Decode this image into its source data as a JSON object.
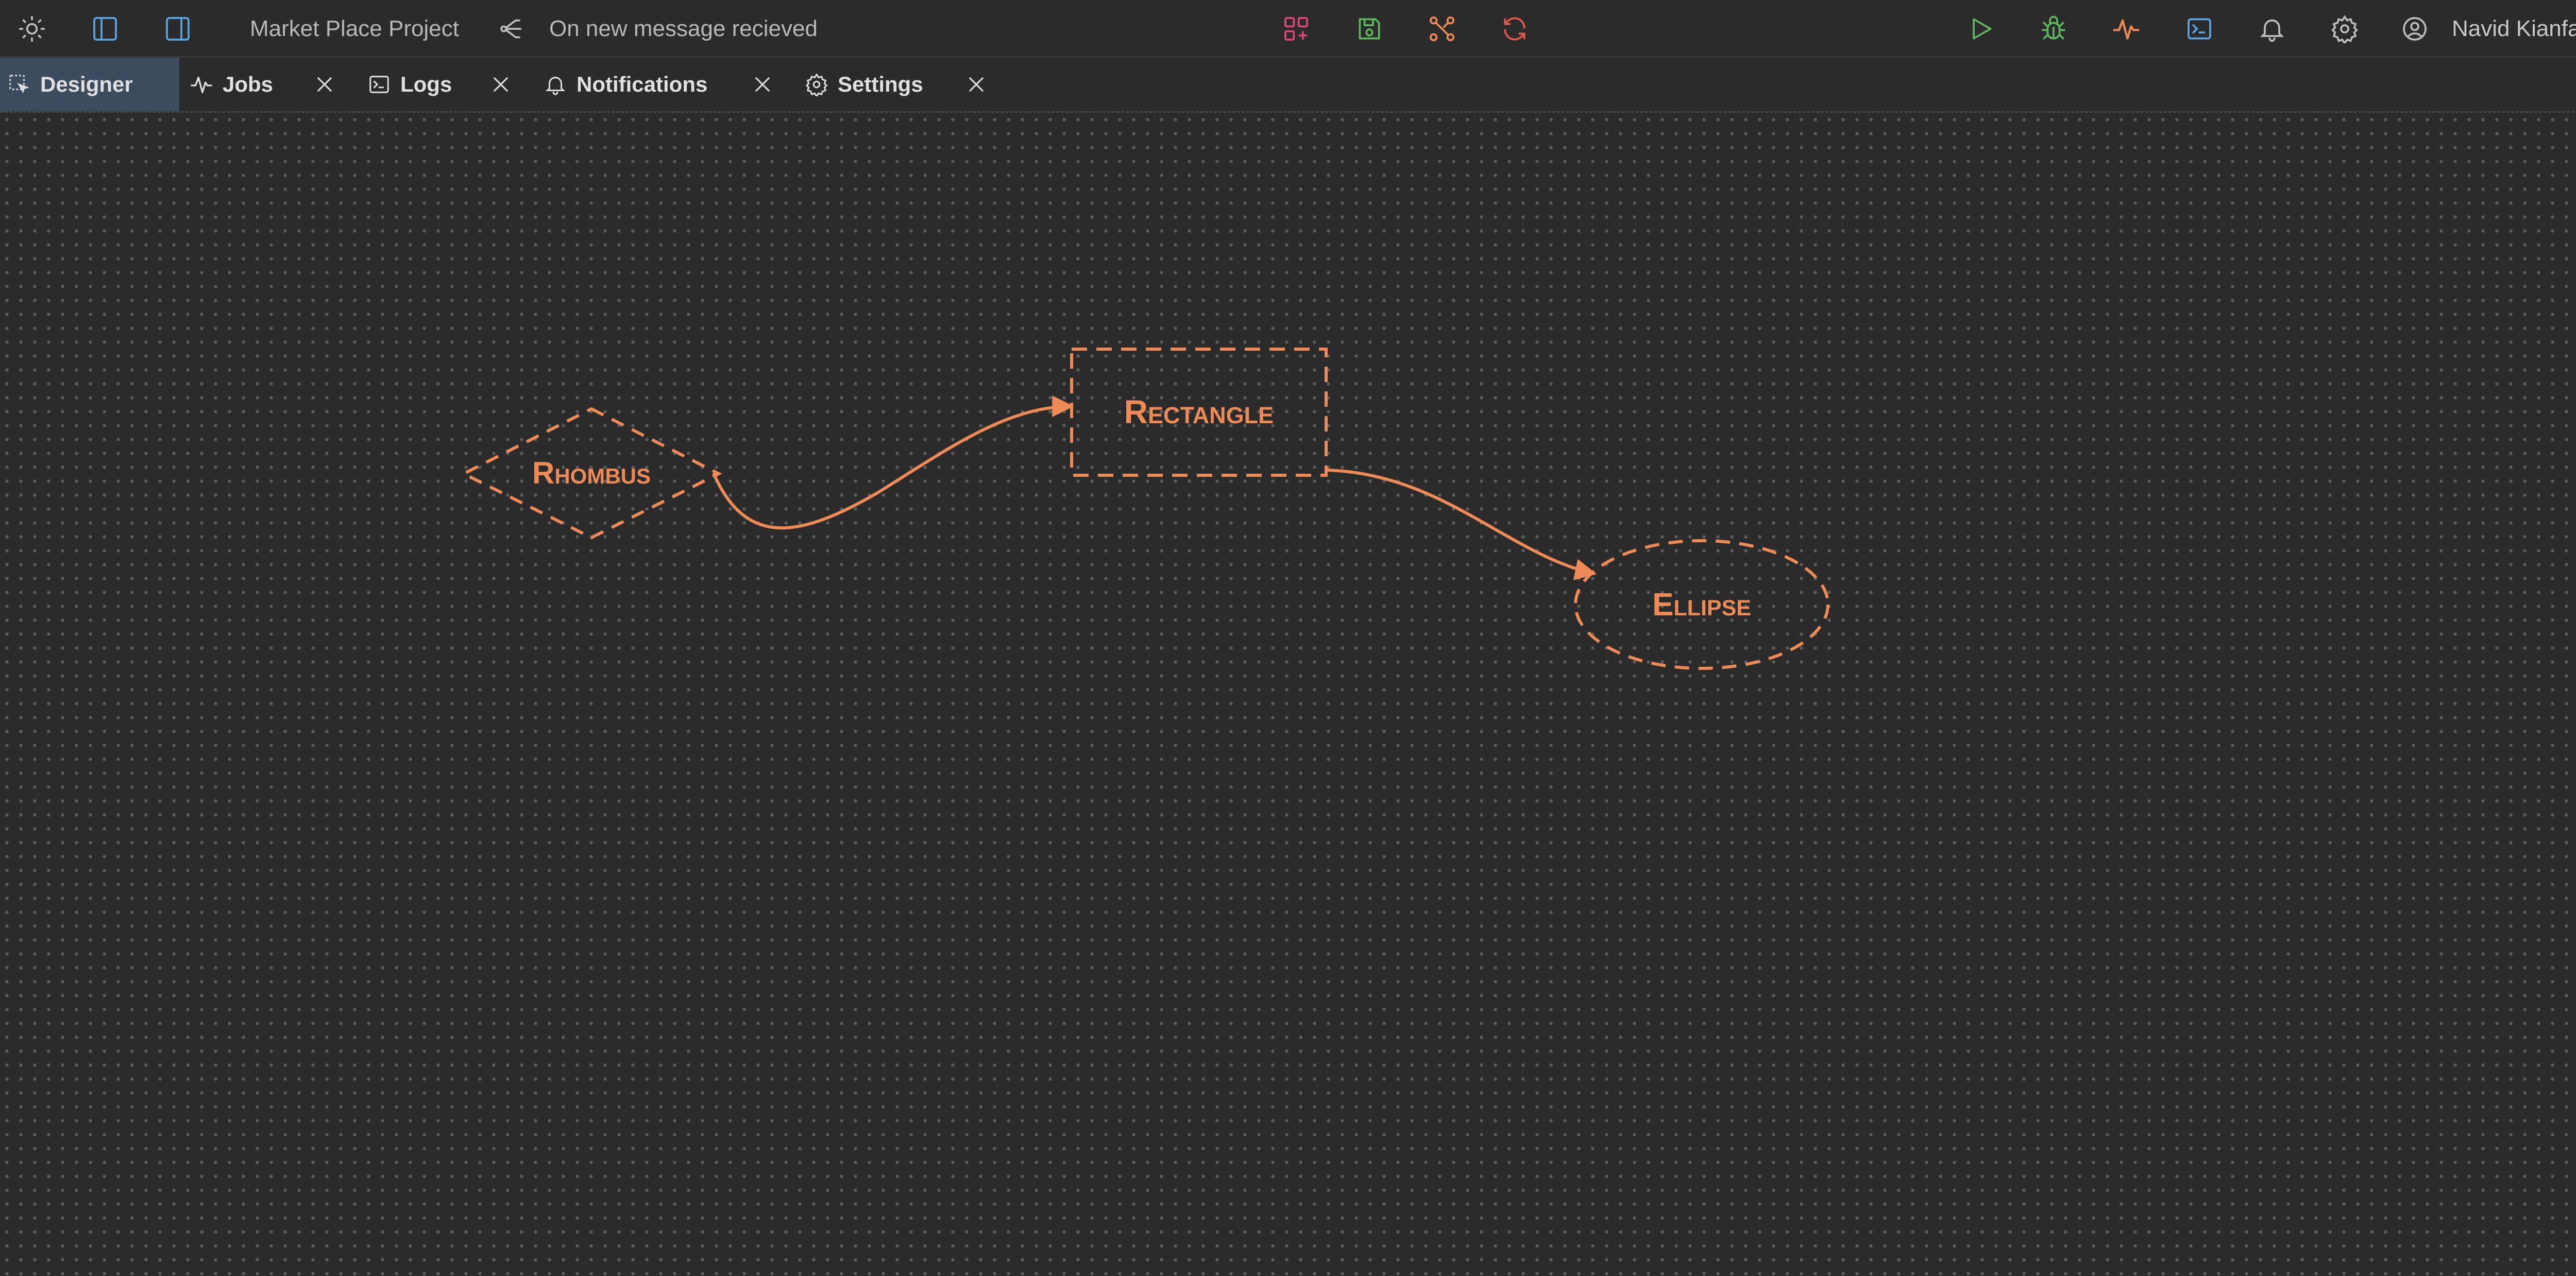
{
  "header": {
    "project_name": "Market Place Project",
    "workflow_name": "On new message recieved",
    "user_name": "Navid Kianfar"
  },
  "tabs": [
    {
      "label": "Designer",
      "active": true,
      "icon": "designer-icon",
      "closable": false
    },
    {
      "label": "Jobs",
      "active": false,
      "icon": "activity-icon",
      "closable": true
    },
    {
      "label": "Logs",
      "active": false,
      "icon": "terminal-icon",
      "closable": true
    },
    {
      "label": "Notifications",
      "active": false,
      "icon": "bell-icon",
      "closable": true
    },
    {
      "label": "Settings",
      "active": false,
      "icon": "gear-icon",
      "closable": true
    }
  ],
  "diagram": {
    "nodes": [
      {
        "id": "rhombus",
        "label": "Rhombus",
        "shape": "rhombus"
      },
      {
        "id": "rectangle",
        "label": "Rectangle",
        "shape": "rectangle"
      },
      {
        "id": "ellipse",
        "label": "Ellipse",
        "shape": "ellipse"
      }
    ],
    "edges": [
      {
        "from": "rhombus",
        "to": "rectangle"
      },
      {
        "from": "rectangle",
        "to": "ellipse"
      }
    ],
    "stroke_color": "#ee8a55"
  },
  "colors": {
    "background": "#2b2b2b",
    "active_tab": "#3c4b5e",
    "accent_blue": "#5aa6e6",
    "accent_pink": "#e0457a",
    "accent_green": "#5cb85c",
    "accent_orange": "#ee8a55",
    "accent_red": "#e35b4f"
  }
}
